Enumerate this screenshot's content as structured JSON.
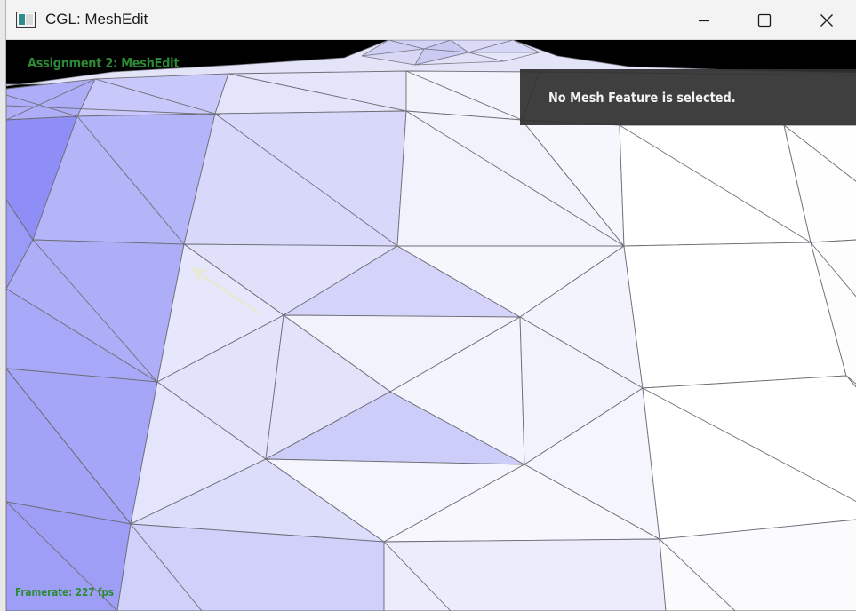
{
  "window": {
    "title": "CGL: MeshEdit",
    "controls": {
      "minimize_icon": "minimize-icon",
      "maximize_icon": "maximize-icon",
      "close_icon": "close-icon"
    }
  },
  "overlay": {
    "assignment_label": "Assignment 2: MeshEdit",
    "info_panel_text": "No Mesh Feature is selected.",
    "framerate_text": "Framerate: 227 fps"
  },
  "colors": {
    "label_green": "#2c8a34",
    "panel_bg": "#303030",
    "mesh_edge": "#6e6e78",
    "mesh_light": "#f4f4fc",
    "mesh_mid": "#d4d4fa",
    "mesh_dark": "#8c8cf4"
  }
}
